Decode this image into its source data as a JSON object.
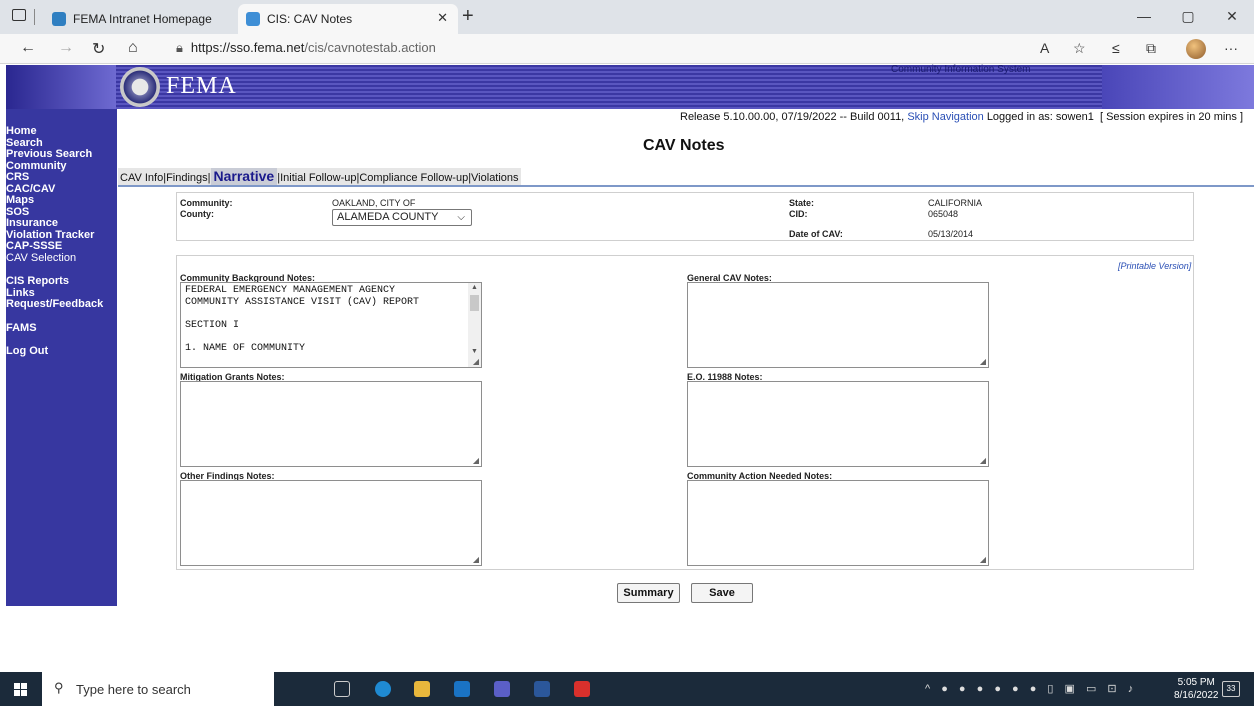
{
  "browser": {
    "tabs": [
      {
        "title": "FEMA Intranet Homepage",
        "active": false
      },
      {
        "title": "CIS: CAV Notes",
        "active": true
      }
    ],
    "url_host": "https://sso.fema.net",
    "url_path": "/cis/cavnotestab.action",
    "window_controls": [
      "—",
      "▢",
      "✕"
    ]
  },
  "header": {
    "logo_text": "FEMA",
    "system_title": "Community Information System",
    "release_text": "Release 5.10.00.00, 07/19/2022 -- Build 0011,",
    "skip_nav": "Skip Navigation",
    "logged_in": "Logged in as: sowen1",
    "session": "[ Session expires in 20 mins ]"
  },
  "sidebar": {
    "items": [
      "Home",
      "Search",
      "Previous Search",
      "Community",
      "CRS",
      "CAC/CAV",
      "Maps",
      "SOS",
      "Insurance",
      "Violation Tracker",
      "CAP-SSSE",
      "CAV Selection",
      "CIS Reports",
      "Links",
      "Request/Feedback",
      "FAMS",
      "Log Out"
    ]
  },
  "page": {
    "title": "CAV Notes",
    "tabs": [
      "CAV Info",
      "Findings",
      "Narrative",
      "Initial Follow-up",
      "Compliance Follow-up",
      "Violations"
    ],
    "active_tab": "Narrative",
    "separator": " | "
  },
  "info": {
    "community_label": "Community:",
    "community_value": "OAKLAND, CITY OF",
    "county_label": "County:",
    "county_value": "ALAMEDA COUNTY",
    "state_label": "State:",
    "state_value": "CALIFORNIA",
    "cid_label": "CID:",
    "cid_value": "065048",
    "date_label": "Date of CAV:",
    "date_value": "05/13/2014"
  },
  "notes": {
    "printable": "[Printable Version]",
    "community_background_label": "Community Background Notes:",
    "community_background_text": "FEDERAL EMERGENCY MANAGEMENT AGENCY\nCOMMUNITY ASSISTANCE VISIT (CAV) REPORT\n\nSECTION I\n\n1. NAME OF COMMUNITY",
    "general_label": "General CAV Notes:",
    "mitigation_label": "Mitigation Grants Notes:",
    "eo_label": "E.O. 11988 Notes:",
    "other_label": "Other Findings Notes:",
    "action_label": "Community Action Needed Notes:"
  },
  "buttons": {
    "summary": "Summary",
    "save": "Save"
  },
  "taskbar": {
    "search_placeholder": "Type here to search",
    "time": "5:05 PM",
    "date": "8/16/2022",
    "notifications": "33"
  },
  "colors": {
    "sidebar": "#3737a0",
    "link": "#2a4fb5",
    "tab_line": "#7e98c8"
  }
}
